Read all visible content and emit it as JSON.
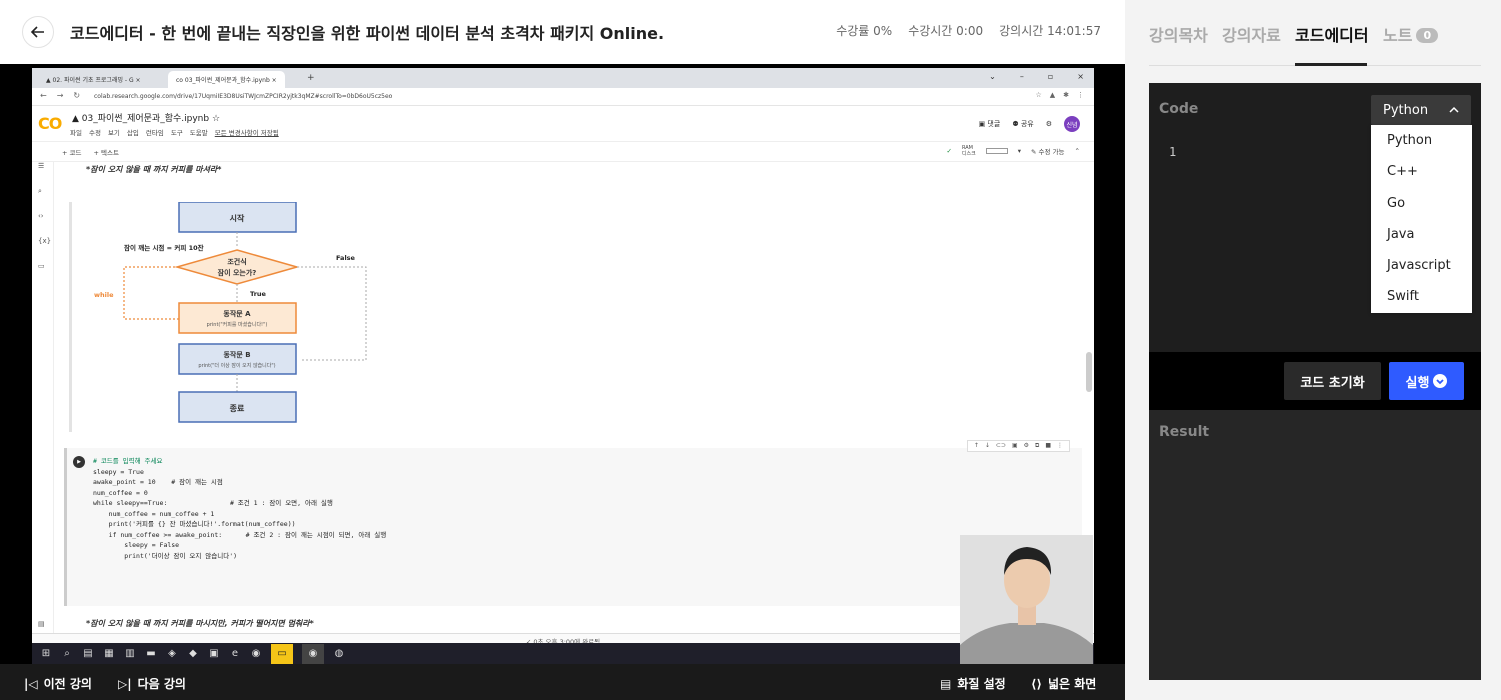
{
  "header": {
    "title": "코드에디터 - 한 번에 끝내는 직장인을 위한 파이썬 데이터 분석 초격차 패키지 Online.",
    "progress": "수강률 0%",
    "watch_time": "수강시간 0:00",
    "lecture_time": "강의시간 14:01:57"
  },
  "browser": {
    "tabs": [
      "02. 파이썬 기초 프로그래밍 - G",
      "03_파이썬_제어문과_함수.ipynb"
    ],
    "url": "colab.research.google.com/drive/17UqmiIE3D8UsiTWJcmZPCIR2yjtk3qMZ#scrollTo=0bD6oU5cz5eo",
    "notebook_title": "03_파이썬_제어문과_함수.ipynb",
    "menu": [
      "파일",
      "수정",
      "보기",
      "삽입",
      "런타임",
      "도구",
      "도움말",
      "모든 변경사항이 저장됨"
    ],
    "top_right": [
      "댓글",
      "공유"
    ],
    "user_initials": "신념",
    "toolbar": [
      "+ 코드",
      "+ 텍스트"
    ],
    "ram_label": "RAM",
    "disk_label": "디스크",
    "edit_mode": "수정 가능",
    "md_text_1": "*잠이 오지 않을 때 까지 커피를 마셔라*",
    "md_text_2": "*잠이 오지 않을 때 까지 커피를 마시지만, 커피가 떨어지면 멈춰라*",
    "status": "✓ 0초    오후 3:00에 완료됨"
  },
  "flowchart": {
    "start": "시작",
    "init_label": "잠이 깨는 시점 = 커피 10잔",
    "cond_line1": "조건식",
    "cond_line2": "잠이 오는가?",
    "false_label": "False",
    "true_label": "True",
    "while_label": "while",
    "action_a": "동작문 A",
    "action_a_code": "print(\"커피를 마셨습니다!\")",
    "action_b": "동작문 B",
    "action_b_code": "print(\"더 이상 잠이 오지 않습니다\")",
    "end": "종료"
  },
  "code_cell": {
    "lines": [
      "# 코드를 입력해 주세요",
      "sleepy = True",
      "awake_point = 10    # 잠이 깨는 시점",
      "",
      "num_coffee = 0",
      "",
      "while sleepy==True:                # 조건 1 : 잠이 오면, 아래 실행",
      "    num_coffee = num_coffee + 1",
      "    print('커피를 {} 잔 마셨습니다!'.format(num_coffee))",
      "",
      "    if num_coffee >= awake_point:      # 조건 2 : 잠이 깨는 시점이 되면, 아래 실행",
      "        sleepy = False",
      "        print('더이상 잠이 오지 않습니다')"
    ]
  },
  "bottom_bar": {
    "prev": "이전 강의",
    "next": "다음 강의",
    "quality": "화질 설정",
    "wide": "넓은 화면"
  },
  "right_panel": {
    "tabs": [
      "강의목차",
      "강의자료",
      "코드에디터",
      "노트"
    ],
    "active_tab": "코드에디터",
    "note_count": "0",
    "code_label": "Code",
    "line_number": "1",
    "selected_language": "Python",
    "languages": [
      "Python",
      "C++",
      "Go",
      "Java",
      "Javascript",
      "Swift"
    ],
    "reset_label": "코드 초기화",
    "run_label": "실행",
    "result_label": "Result"
  },
  "colors": {
    "accent_blue": "#2f5bff",
    "editor_bg": "#1e1e1e",
    "flow_blue": "#4a6fb5",
    "flow_orange": "#ee8a3a"
  }
}
